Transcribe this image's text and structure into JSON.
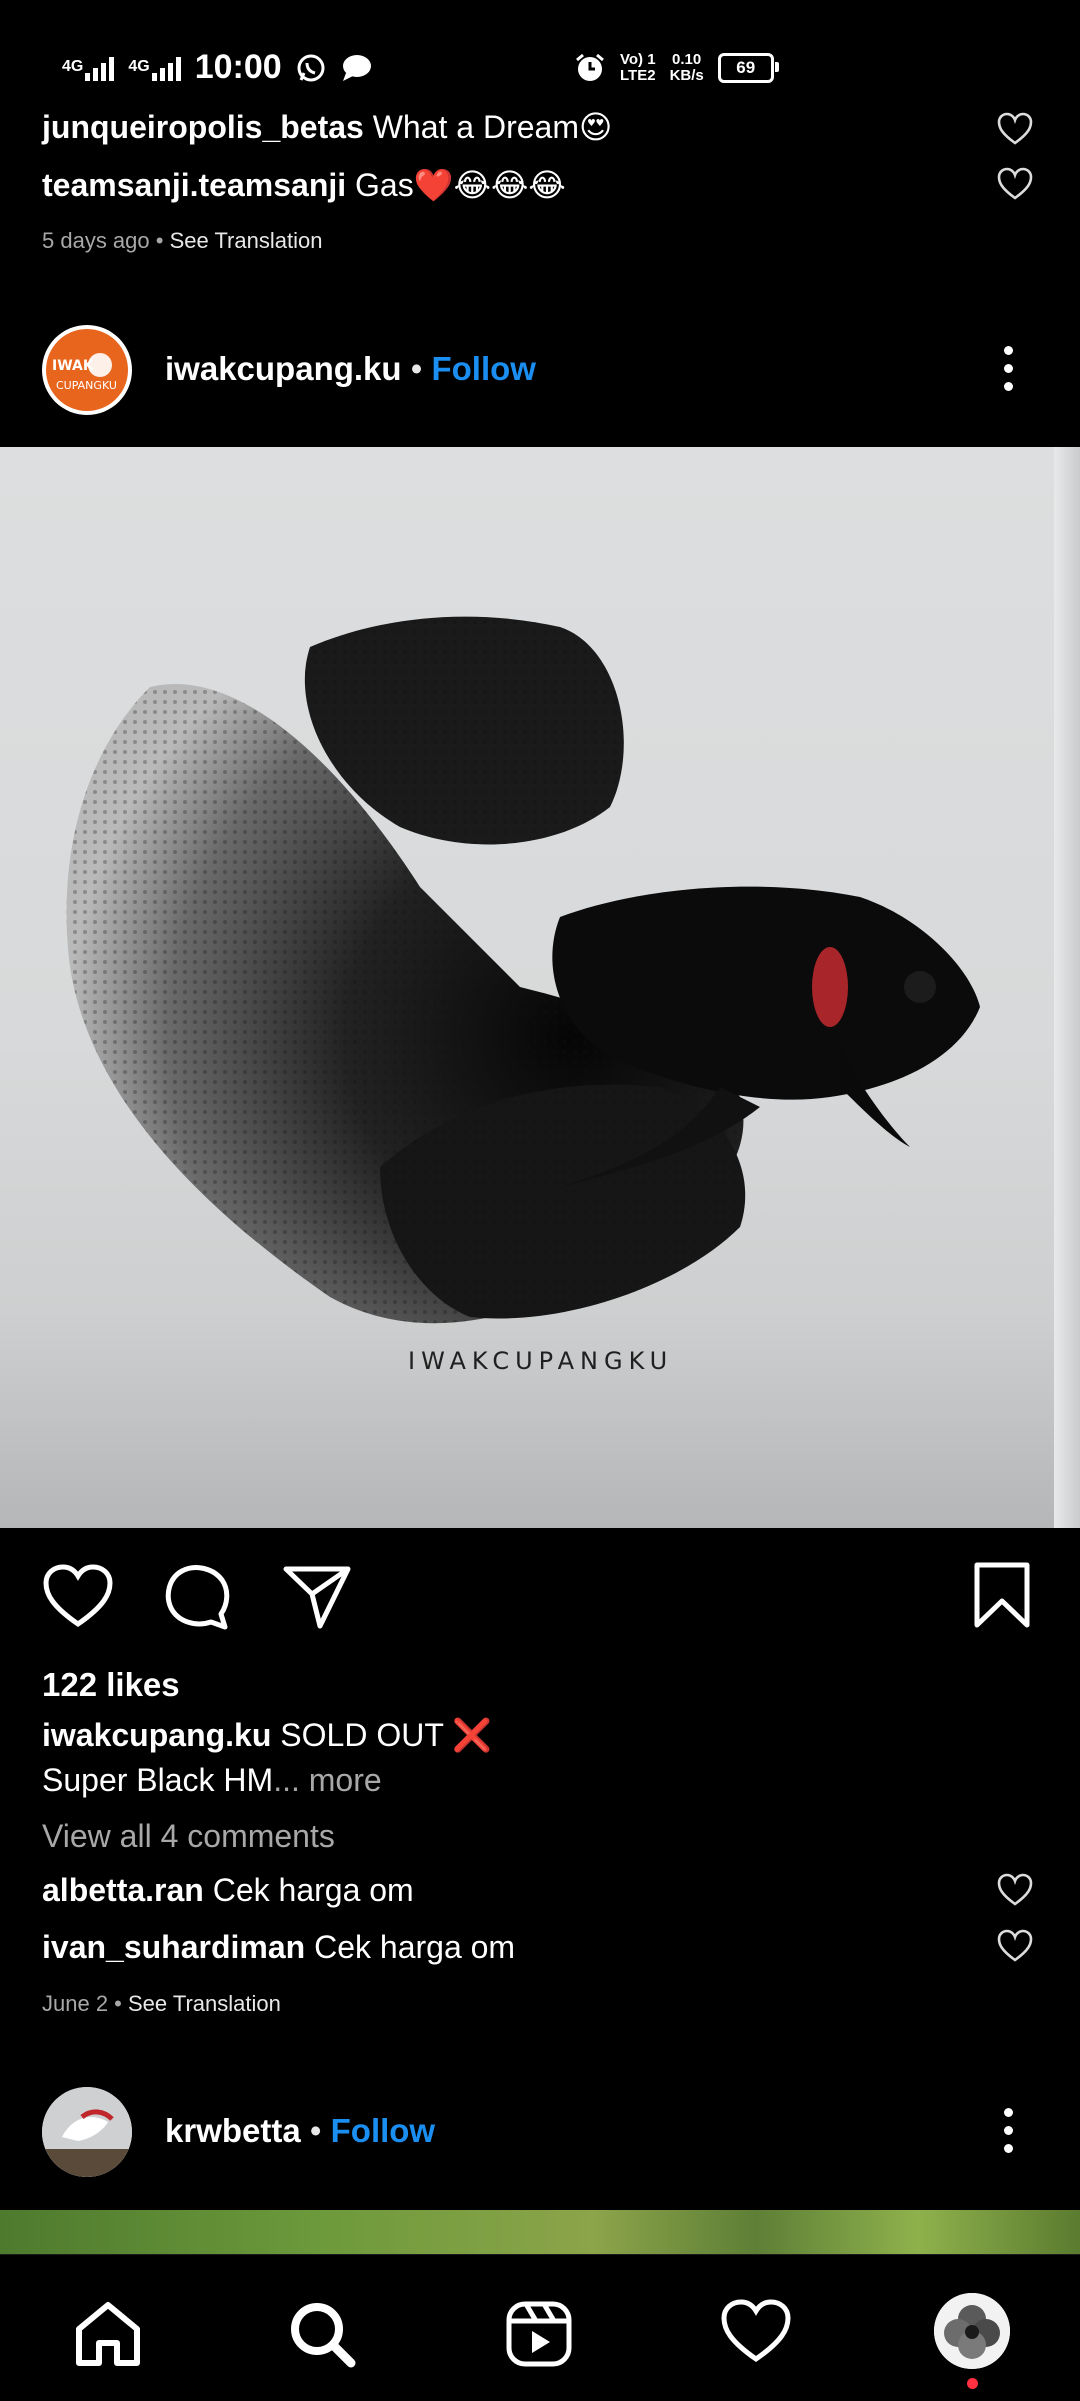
{
  "status_bar": {
    "net1": "4G",
    "net2": "4G",
    "time": "10:00",
    "volte_top": "Vo) 1",
    "volte_bottom": "LTE2",
    "speed_value": "0.10",
    "speed_unit": "KB/s",
    "battery": "69"
  },
  "prev_post": {
    "comments": [
      {
        "user": "junqueiropolis_betas",
        "text": "What a Dream😍"
      },
      {
        "user": "teamsanji.teamsanji",
        "text": "Gas❤️😂😂😂"
      }
    ],
    "date": "5 days ago",
    "translate": "See Translation"
  },
  "post": {
    "username": "iwakcupang.ku",
    "follow": "Follow",
    "separator": "•",
    "avatar_text": "IWAK CUPANGKU",
    "watermark": "IWAKCUPANGKU",
    "likes": "122 likes",
    "caption_user": "iwakcupang.ku",
    "caption_text": "SOLD OUT ❌",
    "caption_line2": "Super Black HM",
    "more": "... more",
    "view_all": "View all 4 comments",
    "comments": [
      {
        "user": "albetta.ran",
        "text": "Cek harga om"
      },
      {
        "user": "ivan_suhardiman",
        "text": "Cek harga om"
      }
    ],
    "date": "June 2",
    "translate": "See Translation"
  },
  "next_post": {
    "username": "krwbetta",
    "follow": "Follow",
    "separator": "•"
  },
  "colors": {
    "background": "#000000",
    "follow_blue": "#1b8ef2",
    "muted_text": "#a8a8a8",
    "notification_dot": "#ff3040"
  },
  "icons": {
    "action_bar": [
      "heart-icon",
      "comment-icon",
      "share-icon",
      "bookmark-icon"
    ],
    "nav": [
      "home-icon",
      "search-icon",
      "reels-icon",
      "activity-heart-icon",
      "profile-avatar"
    ]
  }
}
